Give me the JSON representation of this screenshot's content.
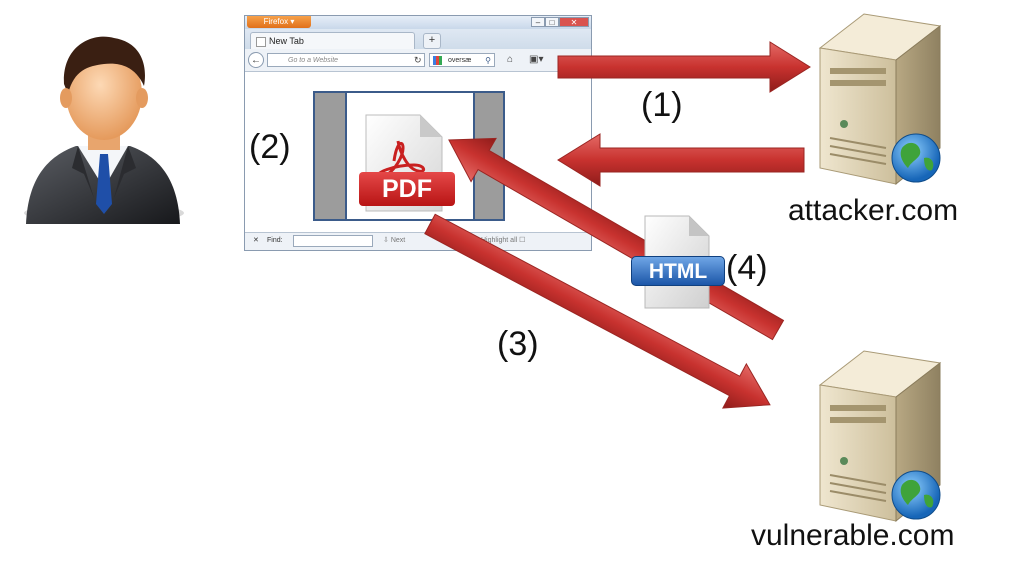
{
  "steps": {
    "s1": "(1)",
    "s2": "(2)",
    "s3": "(3)",
    "s4": "(4)"
  },
  "hosts": {
    "attacker": "attacker.com",
    "vulnerable": "vulnerable.com"
  },
  "browser": {
    "app_button": "Firefox",
    "tab_label": "New Tab",
    "url_placeholder": "Go to a Website",
    "search_value": "oversæ",
    "find_label": "Find:",
    "find_next": "Next",
    "find_highlight": "Highlight all"
  },
  "icons": {
    "pdf_label": "PDF",
    "html_label": "HTML"
  },
  "colors": {
    "arrow_red": "#c8322f",
    "pdf_red": "#c91e1e",
    "html_blue": "#2a6cc4",
    "frame_blue": "#3b5b8a"
  }
}
